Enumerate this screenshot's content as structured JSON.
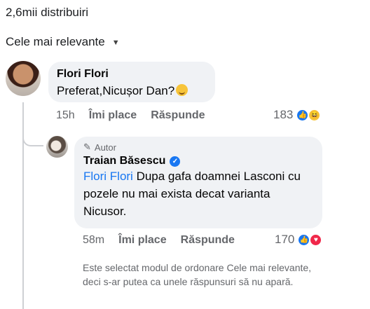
{
  "header": {
    "shares": "2,6mii distribuiri",
    "sort_label": "Cele mai relevante"
  },
  "comment": {
    "author": "Flori Flori",
    "text": "Preferat,Nicușor Dan?",
    "time": "15h",
    "like_label": "Îmi place",
    "reply_label": "Răspunde",
    "reaction_count": "183"
  },
  "reply": {
    "tag": "Autor",
    "author": "Traian Băsescu",
    "mention": "Flori Flori",
    "text": " Dupa gafa doamnei Lasconi cu pozele nu mai exista decat varianta Nicusor.",
    "time": "58m",
    "like_label": "Îmi place",
    "reply_label": "Răspunde",
    "reaction_count": "170"
  },
  "note": "Este selectat modul de ordonare Cele mai relevante, deci s-ar putea ca unele răspunsuri să nu apară."
}
